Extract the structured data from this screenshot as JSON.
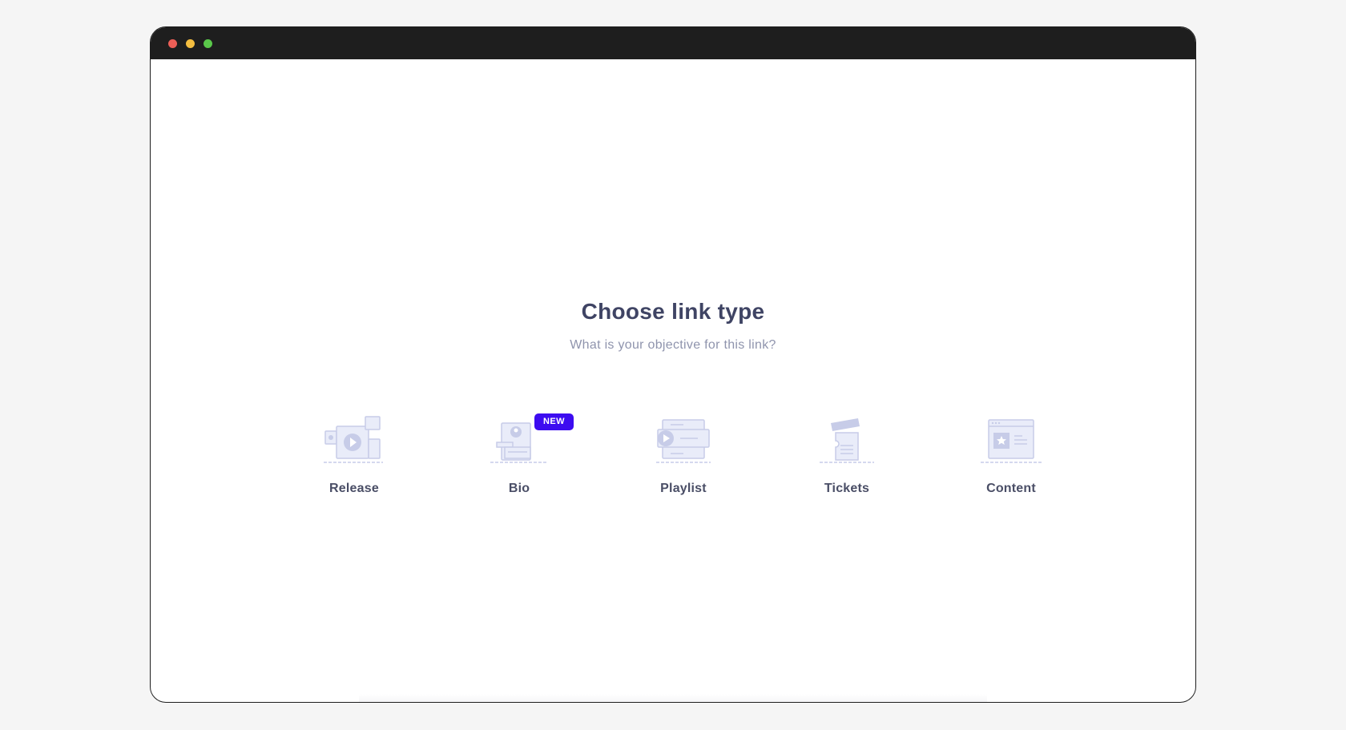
{
  "window": {
    "controls": [
      {
        "name": "close",
        "color": "#ed5f57"
      },
      {
        "name": "minimize",
        "color": "#f4be40"
      },
      {
        "name": "maximize",
        "color": "#5ac84a"
      }
    ]
  },
  "page": {
    "title": "Choose link type",
    "subtitle": "What is your objective for this link?"
  },
  "link_types": [
    {
      "label": "Release",
      "icon": "release-icon"
    },
    {
      "label": "Bio",
      "icon": "bio-icon",
      "badge": "NEW"
    },
    {
      "label": "Playlist",
      "icon": "playlist-icon"
    },
    {
      "label": "Tickets",
      "icon": "tickets-icon"
    },
    {
      "label": "Content",
      "icon": "content-icon"
    }
  ],
  "colors": {
    "badge": "#3d0cf0",
    "icon_stroke": "#c7cce8",
    "icon_fill": "#e9ecf9"
  }
}
